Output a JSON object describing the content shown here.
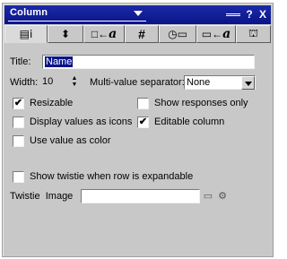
{
  "window": {
    "title": "Column",
    "menu_icon": "menu-icon",
    "help_label": "?",
    "close_label": "X"
  },
  "tabs": [
    {
      "name": "basics-tab",
      "icon": "column-info-icon",
      "glyph": "▤ⅰ"
    },
    {
      "name": "sorting-tab",
      "icon": "sort-icon",
      "glyph": "⬍"
    },
    {
      "name": "title-font-tab",
      "icon": "font-icon",
      "glyph_a": "□←",
      "glyph_b": "a"
    },
    {
      "name": "number-tab",
      "icon": "hash-icon",
      "glyph": "#"
    },
    {
      "name": "datetime-tab",
      "icon": "clock-icon",
      "glyph": "◷▭"
    },
    {
      "name": "header-font-tab",
      "icon": "header-font-icon",
      "glyph_a": "▭←",
      "glyph_b": "a"
    },
    {
      "name": "advanced-tab",
      "icon": "hat-icon",
      "glyph": "⛫"
    }
  ],
  "form": {
    "title_label": "Title:",
    "title_value": "Name",
    "width_label": "Width:",
    "width_value": "10",
    "separator_label": "Multi-value separator:",
    "separator_value": "None",
    "resizable_label": "Resizable",
    "resizable_checked": "✔",
    "show_responses_label": "Show responses only",
    "show_responses_checked": "",
    "display_icons_label": "Display values as icons",
    "display_icons_checked": "",
    "editable_label": "Editable column",
    "editable_checked": "✔",
    "use_color_label": "Use value as color",
    "use_color_checked": "",
    "twistie_expandable_label": "Show twistie when row is expandable",
    "twistie_expandable_checked": "",
    "twistie_image_label": "Twistie  Image",
    "twistie_image_value": ""
  },
  "colors": {
    "titlebar": "#0a1488",
    "panel": "#c8c8c8",
    "selection": "#0a1488"
  }
}
